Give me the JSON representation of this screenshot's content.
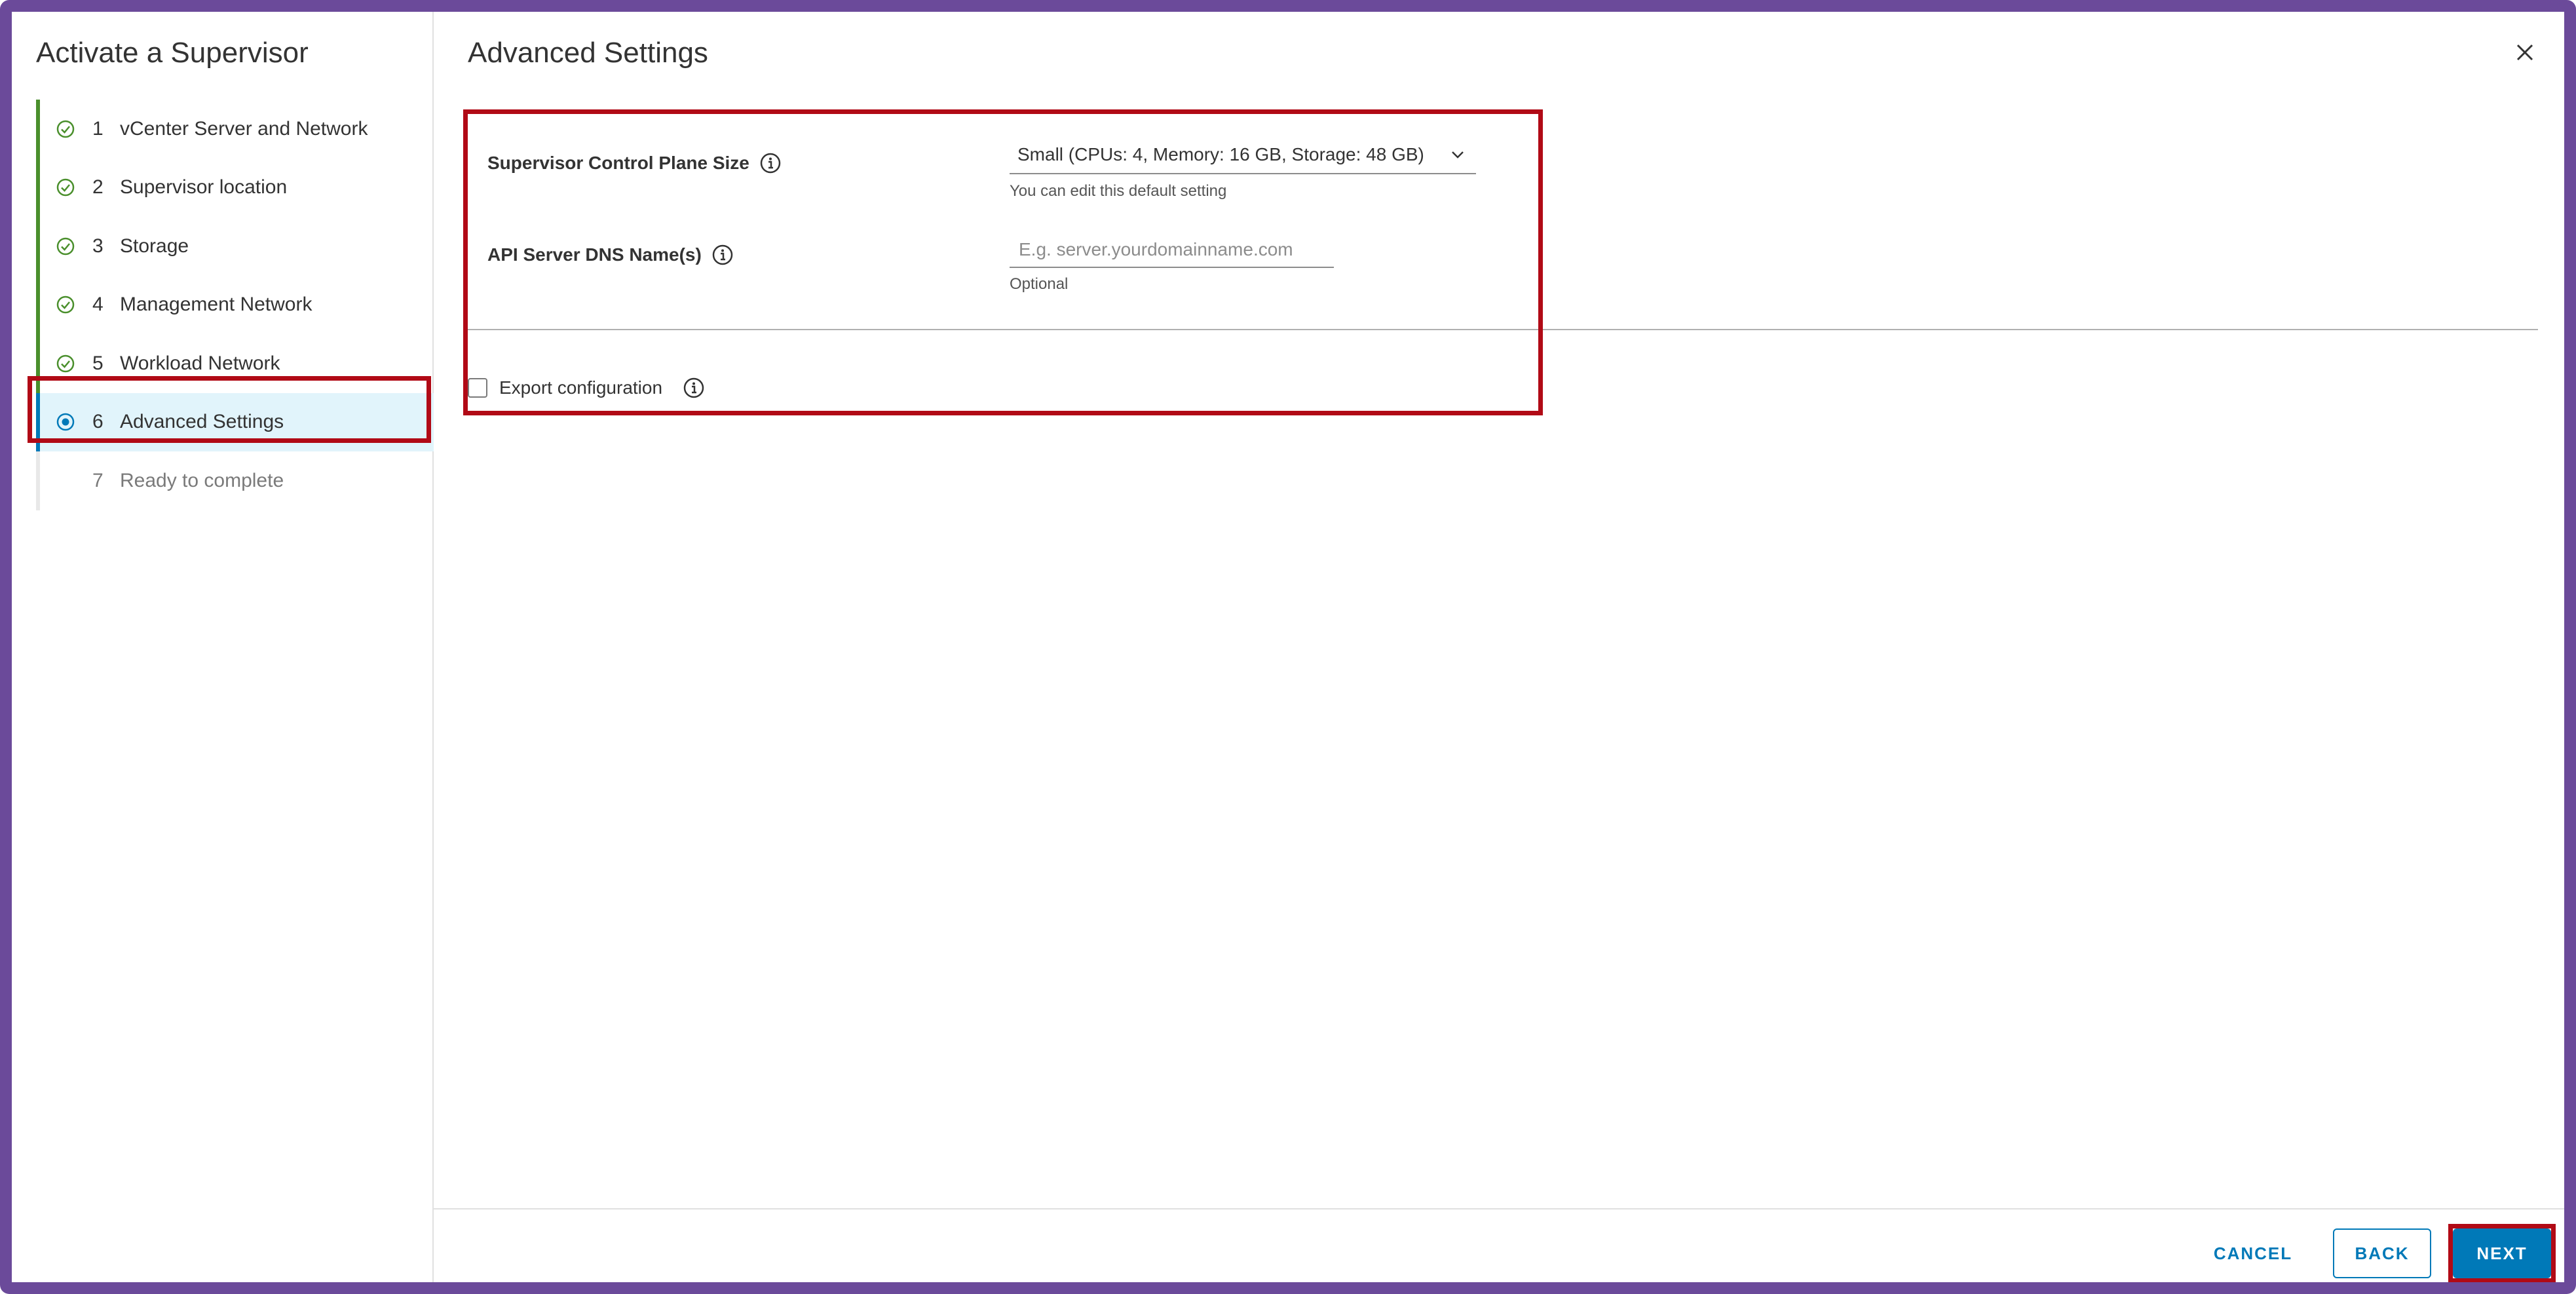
{
  "wizard": {
    "title": "Activate a Supervisor",
    "steps": [
      {
        "num": "1",
        "label": "vCenter Server and Network",
        "state": "complete"
      },
      {
        "num": "2",
        "label": "Supervisor location",
        "state": "complete"
      },
      {
        "num": "3",
        "label": "Storage",
        "state": "complete"
      },
      {
        "num": "4",
        "label": "Management Network",
        "state": "complete"
      },
      {
        "num": "5",
        "label": "Workload Network",
        "state": "complete"
      },
      {
        "num": "6",
        "label": "Advanced Settings",
        "state": "active"
      },
      {
        "num": "7",
        "label": "Ready to complete",
        "state": "pending"
      }
    ]
  },
  "page": {
    "title": "Advanced Settings"
  },
  "form": {
    "control_plane": {
      "label": "Supervisor Control Plane Size",
      "value": "Small (CPUs: 4, Memory: 16 GB, Storage: 48 GB)",
      "helper": "You can edit this default setting"
    },
    "dns": {
      "label": "API Server DNS Name(s)",
      "placeholder": "E.g. server.yourdomainname.com",
      "helper": "Optional"
    },
    "export": {
      "label": "Export configuration"
    }
  },
  "footer": {
    "cancel_label": "CANCEL",
    "back_label": "BACK",
    "next_label": "NEXT"
  },
  "colors": {
    "accent": "#0079b8",
    "complete": "#4a8f2c",
    "highlight": "#b10a16",
    "frame": "#6b4a9a"
  }
}
